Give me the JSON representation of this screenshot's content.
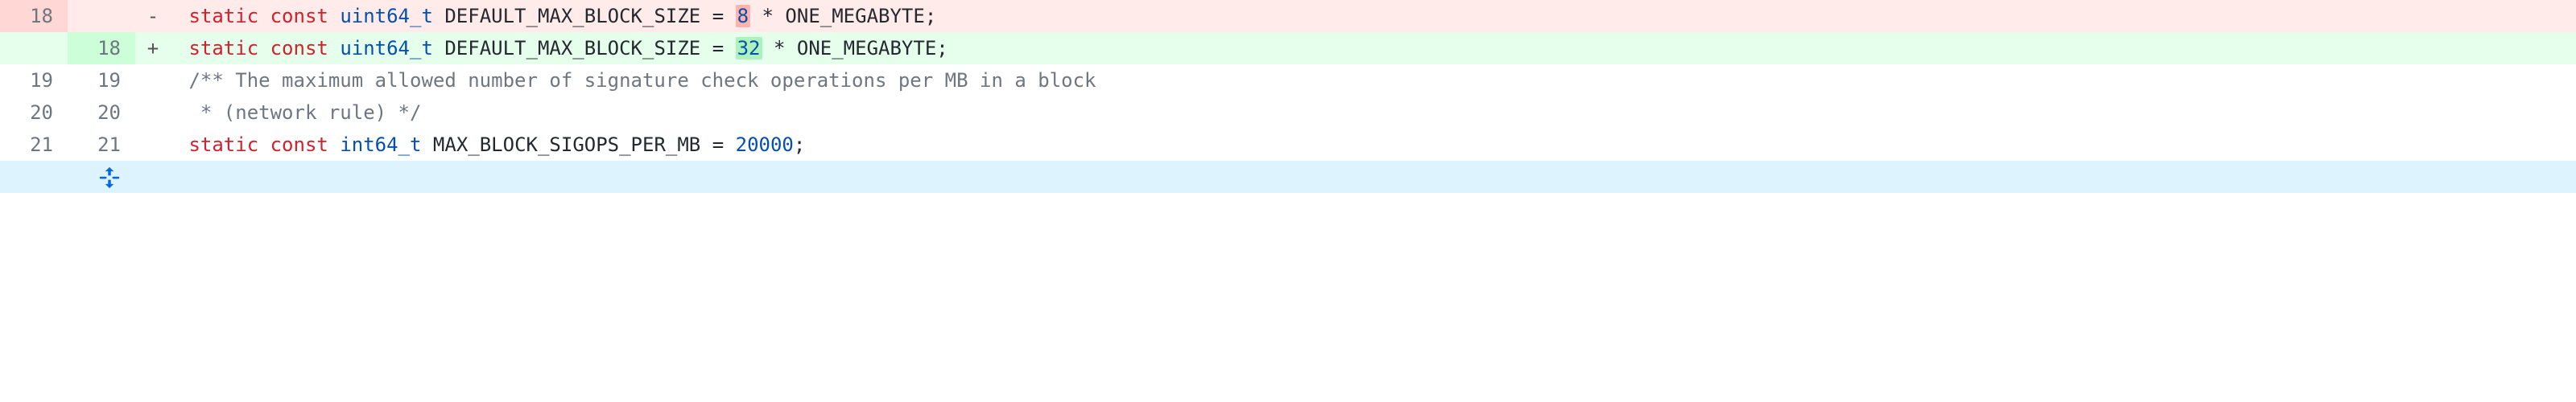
{
  "diff": {
    "rows": [
      {
        "type": "deletion",
        "old_num": "18",
        "new_num": "",
        "marker": "-",
        "tokens": [
          {
            "kind": "plain",
            "text": " "
          },
          {
            "kind": "keyword",
            "text": "static"
          },
          {
            "kind": "plain",
            "text": " "
          },
          {
            "kind": "keyword",
            "text": "const"
          },
          {
            "kind": "plain",
            "text": " "
          },
          {
            "kind": "type",
            "text": "uint64_t"
          },
          {
            "kind": "plain",
            "text": " "
          },
          {
            "kind": "ident",
            "text": "DEFAULT_MAX_BLOCK_SIZE"
          },
          {
            "kind": "plain",
            "text": " "
          },
          {
            "kind": "op",
            "text": "="
          },
          {
            "kind": "plain",
            "text": " "
          },
          {
            "kind": "number",
            "text": "8",
            "highlight": "del"
          },
          {
            "kind": "plain",
            "text": " "
          },
          {
            "kind": "op",
            "text": "*"
          },
          {
            "kind": "plain",
            "text": " "
          },
          {
            "kind": "ident",
            "text": "ONE_MEGABYTE"
          },
          {
            "kind": "op",
            "text": ";"
          }
        ]
      },
      {
        "type": "addition",
        "old_num": "",
        "new_num": "18",
        "marker": "+",
        "tokens": [
          {
            "kind": "plain",
            "text": " "
          },
          {
            "kind": "keyword",
            "text": "static"
          },
          {
            "kind": "plain",
            "text": " "
          },
          {
            "kind": "keyword",
            "text": "const"
          },
          {
            "kind": "plain",
            "text": " "
          },
          {
            "kind": "type",
            "text": "uint64_t"
          },
          {
            "kind": "plain",
            "text": " "
          },
          {
            "kind": "ident",
            "text": "DEFAULT_MAX_BLOCK_SIZE"
          },
          {
            "kind": "plain",
            "text": " "
          },
          {
            "kind": "op",
            "text": "="
          },
          {
            "kind": "plain",
            "text": " "
          },
          {
            "kind": "number",
            "text": "32",
            "highlight": "add"
          },
          {
            "kind": "plain",
            "text": " "
          },
          {
            "kind": "op",
            "text": "*"
          },
          {
            "kind": "plain",
            "text": " "
          },
          {
            "kind": "ident",
            "text": "ONE_MEGABYTE"
          },
          {
            "kind": "op",
            "text": ";"
          }
        ]
      },
      {
        "type": "context",
        "old_num": "19",
        "new_num": "19",
        "marker": "",
        "tokens": [
          {
            "kind": "plain",
            "text": " "
          },
          {
            "kind": "comment",
            "text": "/** The maximum allowed number of signature check operations per MB in a block"
          }
        ]
      },
      {
        "type": "context",
        "old_num": "20",
        "new_num": "20",
        "marker": "",
        "tokens": [
          {
            "kind": "plain",
            "text": " "
          },
          {
            "kind": "comment",
            "text": " * (network rule) */"
          }
        ]
      },
      {
        "type": "context",
        "old_num": "21",
        "new_num": "21",
        "marker": "",
        "tokens": [
          {
            "kind": "plain",
            "text": " "
          },
          {
            "kind": "keyword",
            "text": "static"
          },
          {
            "kind": "plain",
            "text": " "
          },
          {
            "kind": "keyword",
            "text": "const"
          },
          {
            "kind": "plain",
            "text": " "
          },
          {
            "kind": "type",
            "text": "int64_t"
          },
          {
            "kind": "plain",
            "text": " "
          },
          {
            "kind": "ident",
            "text": "MAX_BLOCK_SIGOPS_PER_MB"
          },
          {
            "kind": "plain",
            "text": " "
          },
          {
            "kind": "op",
            "text": "="
          },
          {
            "kind": "plain",
            "text": " "
          },
          {
            "kind": "number",
            "text": "20000"
          },
          {
            "kind": "op",
            "text": ";"
          }
        ]
      },
      {
        "type": "hunk",
        "old_num": "",
        "new_num": "",
        "marker": "",
        "tokens": []
      }
    ]
  }
}
